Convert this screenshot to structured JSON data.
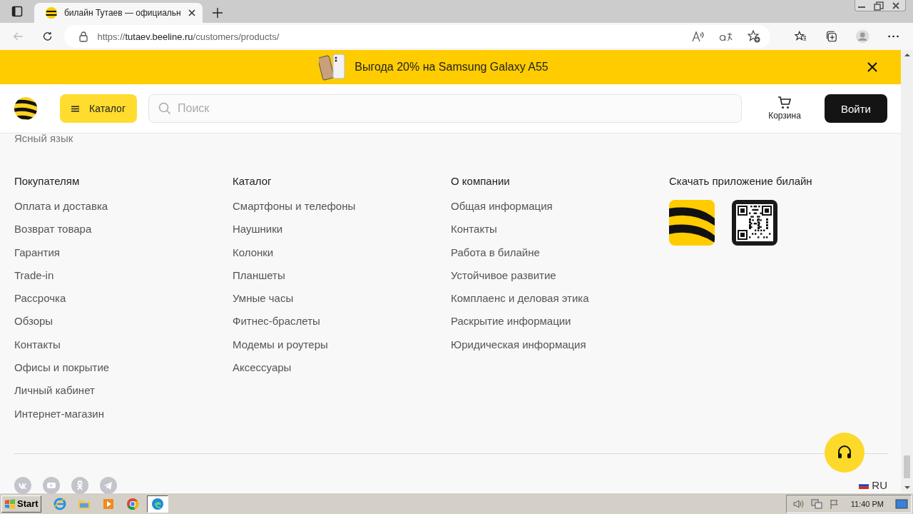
{
  "browser": {
    "tab_title": "билайн Тутаев — официальн",
    "url": {
      "scheme": "https://",
      "host": "tutaev.beeline.ru",
      "path": "/customers/products/"
    }
  },
  "promo": {
    "text": "Выгода 20% на Samsung Galaxy A55"
  },
  "header": {
    "catalog": "Каталог",
    "search_placeholder": "Поиск",
    "cart": "Корзина",
    "login": "Войти"
  },
  "top_link": "Ясный язык",
  "footer_columns": [
    {
      "heading": "Покупателям",
      "links": [
        "Оплата и доставка",
        "Возврат товара",
        "Гарантия",
        "Trade-in",
        "Рассрочка",
        "Обзоры",
        "Контакты",
        "Офисы и покрытие",
        "Личный кабинет",
        "Интернет-магазин"
      ]
    },
    {
      "heading": "Каталог",
      "links": [
        "Смартфоны и телефоны",
        "Наушники",
        "Колонки",
        "Планшеты",
        "Умные часы",
        "Фитнес-браслеты",
        "Модемы и роутеры",
        "Аксессуары"
      ]
    },
    {
      "heading": "О компании",
      "links": [
        "Общая информация",
        "Контакты",
        "Работа в билайне",
        "Устойчивое развитие",
        "Комплаенс и деловая этика",
        "Раскрытие информации",
        "Юридическая информация"
      ]
    }
  ],
  "app": {
    "heading": "Скачать приложение билайн"
  },
  "social": [
    {
      "kind": "vk"
    },
    {
      "kind": "youtube"
    },
    {
      "kind": "ok"
    },
    {
      "kind": "telegram"
    }
  ],
  "language": "RU",
  "taskbar": {
    "start": "Start",
    "clock": "11:40 PM",
    "apps": [
      {
        "kind": "ie",
        "selected": false
      },
      {
        "kind": "folder",
        "selected": false
      },
      {
        "kind": "media",
        "selected": false
      },
      {
        "kind": "chrome",
        "selected": false
      },
      {
        "kind": "edge",
        "selected": true
      }
    ]
  }
}
